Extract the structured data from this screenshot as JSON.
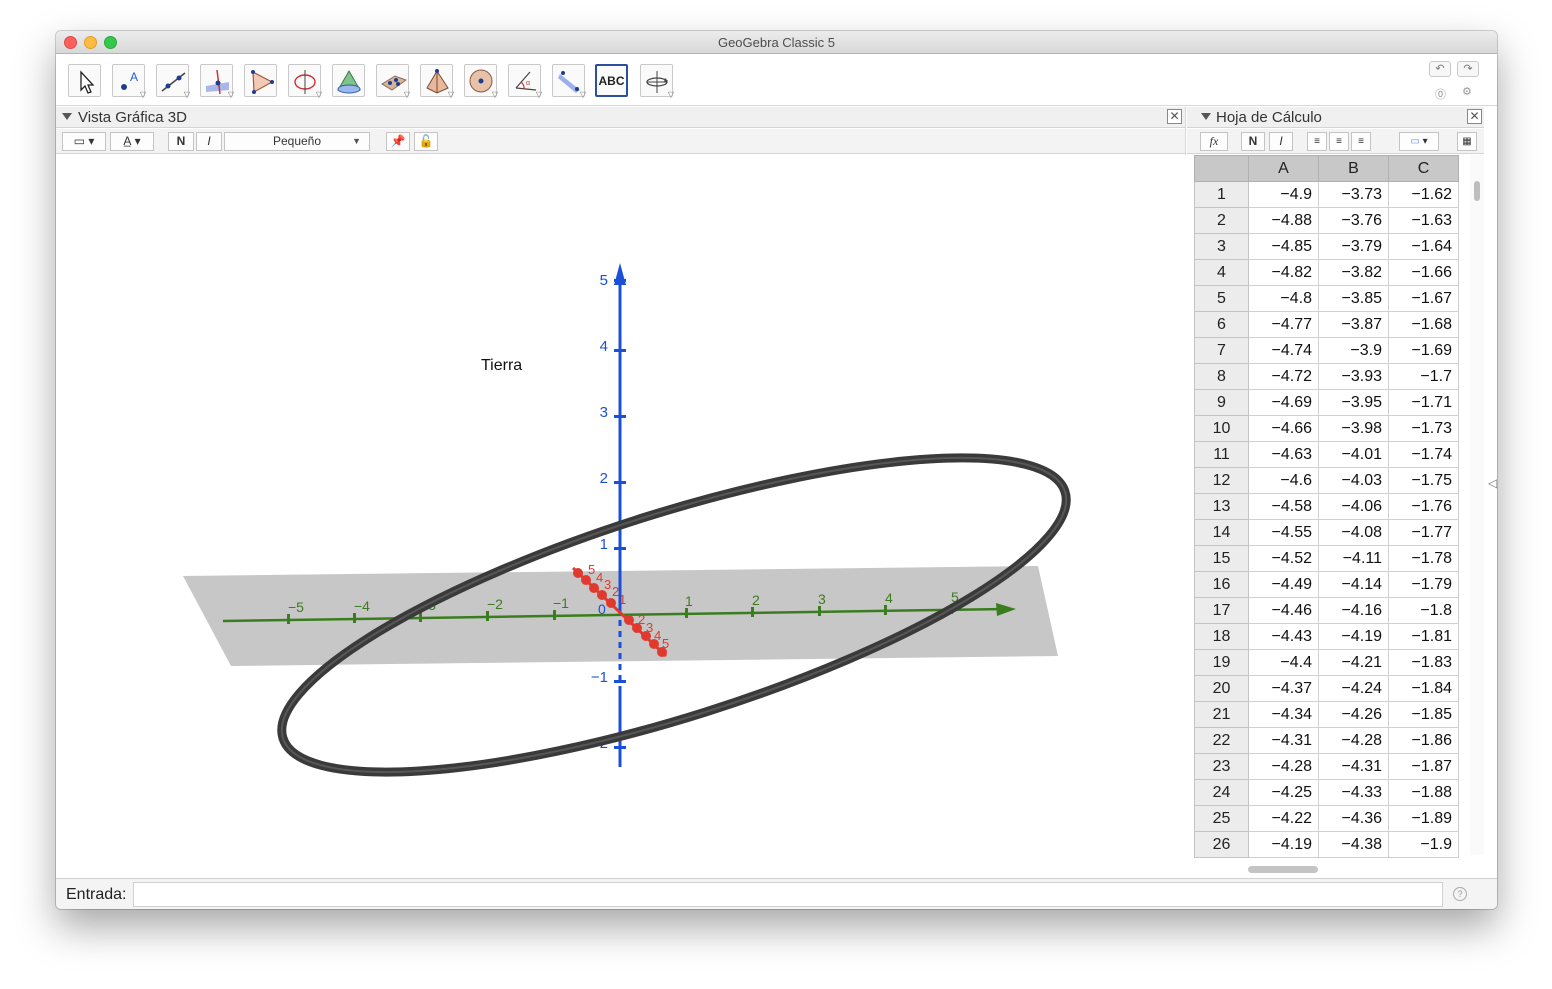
{
  "window": {
    "title": "GeoGebra Classic 5"
  },
  "toolbar": {
    "tools": [
      {
        "name": "move-tool",
        "icon": "arrow-cursor-icon"
      },
      {
        "name": "point-tool",
        "icon": "point-a-icon"
      },
      {
        "name": "line-tool",
        "icon": "line-through-points-icon"
      },
      {
        "name": "perpendicular-tool",
        "icon": "perpendicular-line-icon"
      },
      {
        "name": "polygon-tool",
        "icon": "polygon-icon"
      },
      {
        "name": "circle-axis-tool",
        "icon": "circle-around-axis-icon"
      },
      {
        "name": "intersect-surfaces-tool",
        "icon": "intersect-surfaces-icon"
      },
      {
        "name": "plane-tool",
        "icon": "plane-through-points-icon"
      },
      {
        "name": "pyramid-tool",
        "icon": "pyramid-icon"
      },
      {
        "name": "sphere-tool",
        "icon": "sphere-icon"
      },
      {
        "name": "angle-tool",
        "icon": "angle-icon"
      },
      {
        "name": "reflect-tool",
        "icon": "reflect-about-plane-icon"
      },
      {
        "name": "text-tool",
        "icon": "text-abc-icon",
        "label": "ABC"
      },
      {
        "name": "rotate-view-tool",
        "icon": "rotate-3d-view-icon"
      }
    ]
  },
  "view3d": {
    "title": "Vista Gráfica 3D",
    "style_bar": {
      "bold": "N",
      "italic": "I",
      "size": "Pequeño"
    },
    "text_label": "Tierra",
    "axes": {
      "x_ticks": [
        "−5",
        "−4",
        "−3",
        "−2",
        "−1",
        "1",
        "2",
        "3",
        "4",
        "5"
      ],
      "z_ticks": [
        "5",
        "4",
        "3",
        "2",
        "1",
        "−1",
        "−2"
      ],
      "y_ticks": [
        "5",
        "4",
        "3",
        "2",
        "1",
        "2",
        "3",
        "4",
        "5"
      ],
      "origin": "0",
      "colors": {
        "x": "#3a7d1e",
        "y": "#e03a2e",
        "z": "#1a4fd8"
      }
    },
    "orbit_color": "#3a3a3a",
    "plane_color": "#bdbdbd"
  },
  "spreadsheet": {
    "title": "Hoja de Cálculo",
    "style_bar": {
      "fx": "fx",
      "bold": "N",
      "italic": "I"
    },
    "columns": [
      "A",
      "B",
      "C"
    ],
    "rows": [
      {
        "n": "1",
        "a": "−4.9",
        "b": "−3.73",
        "c": "−1.62"
      },
      {
        "n": "2",
        "a": "−4.88",
        "b": "−3.76",
        "c": "−1.63"
      },
      {
        "n": "3",
        "a": "−4.85",
        "b": "−3.79",
        "c": "−1.64"
      },
      {
        "n": "4",
        "a": "−4.82",
        "b": "−3.82",
        "c": "−1.66"
      },
      {
        "n": "5",
        "a": "−4.8",
        "b": "−3.85",
        "c": "−1.67"
      },
      {
        "n": "6",
        "a": "−4.77",
        "b": "−3.87",
        "c": "−1.68"
      },
      {
        "n": "7",
        "a": "−4.74",
        "b": "−3.9",
        "c": "−1.69"
      },
      {
        "n": "8",
        "a": "−4.72",
        "b": "−3.93",
        "c": "−1.7"
      },
      {
        "n": "9",
        "a": "−4.69",
        "b": "−3.95",
        "c": "−1.71"
      },
      {
        "n": "10",
        "a": "−4.66",
        "b": "−3.98",
        "c": "−1.73"
      },
      {
        "n": "11",
        "a": "−4.63",
        "b": "−4.01",
        "c": "−1.74"
      },
      {
        "n": "12",
        "a": "−4.6",
        "b": "−4.03",
        "c": "−1.75"
      },
      {
        "n": "13",
        "a": "−4.58",
        "b": "−4.06",
        "c": "−1.76"
      },
      {
        "n": "14",
        "a": "−4.55",
        "b": "−4.08",
        "c": "−1.77"
      },
      {
        "n": "15",
        "a": "−4.52",
        "b": "−4.11",
        "c": "−1.78"
      },
      {
        "n": "16",
        "a": "−4.49",
        "b": "−4.14",
        "c": "−1.79"
      },
      {
        "n": "17",
        "a": "−4.46",
        "b": "−4.16",
        "c": "−1.8"
      },
      {
        "n": "18",
        "a": "−4.43",
        "b": "−4.19",
        "c": "−1.81"
      },
      {
        "n": "19",
        "a": "−4.4",
        "b": "−4.21",
        "c": "−1.83"
      },
      {
        "n": "20",
        "a": "−4.37",
        "b": "−4.24",
        "c": "−1.84"
      },
      {
        "n": "21",
        "a": "−4.34",
        "b": "−4.26",
        "c": "−1.85"
      },
      {
        "n": "22",
        "a": "−4.31",
        "b": "−4.28",
        "c": "−1.86"
      },
      {
        "n": "23",
        "a": "−4.28",
        "b": "−4.31",
        "c": "−1.87"
      },
      {
        "n": "24",
        "a": "−4.25",
        "b": "−4.33",
        "c": "−1.88"
      },
      {
        "n": "25",
        "a": "−4.22",
        "b": "−4.36",
        "c": "−1.89"
      },
      {
        "n": "26",
        "a": "−4.19",
        "b": "−4.38",
        "c": "−1.9"
      }
    ]
  },
  "input_bar": {
    "label": "Entrada:",
    "value": "",
    "placeholder": ""
  }
}
